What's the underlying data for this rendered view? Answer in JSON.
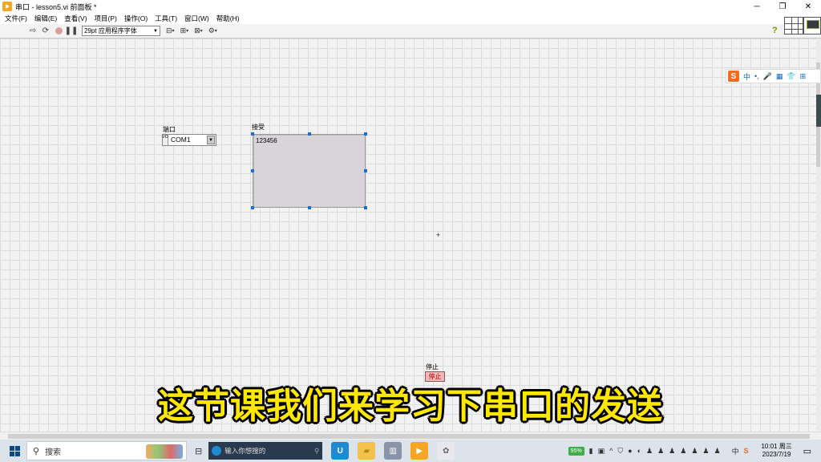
{
  "window": {
    "title": "串口 - lesson5.vi 前面板 *",
    "controls": {
      "minimize": "─",
      "maximize": "❐",
      "close": "✕"
    }
  },
  "menu": [
    "文件(F)",
    "编辑(E)",
    "查看(V)",
    "项目(P)",
    "操作(O)",
    "工具(T)",
    "窗口(W)",
    "帮助(H)"
  ],
  "toolbar": {
    "font_select": "29pt 应用程序字体",
    "help": "?"
  },
  "panel": {
    "port": {
      "label": "端口",
      "value": "COM1",
      "io_tag": "I/O"
    },
    "receive": {
      "label": "接受",
      "value": "123456"
    },
    "stop": {
      "label": "停止",
      "button": "停止"
    }
  },
  "subtitle": "这节课我们来学习下串口的发送",
  "ime": {
    "logo": "S",
    "mode": "中",
    "items": [
      "•,",
      "🎤",
      "▦",
      "👕",
      "⊞"
    ]
  },
  "taskbar": {
    "search_placeholder": "搜索",
    "edge_search_placeholder": "输入你想搜的",
    "battery": "95%",
    "ime_indicator": "中",
    "time": "10:01 周三",
    "date": "2023/7/19"
  },
  "colors": {
    "subtitle": "#ffe800",
    "selection_handle": "#1a6fd6",
    "stop_button": "#f0b8b8"
  }
}
